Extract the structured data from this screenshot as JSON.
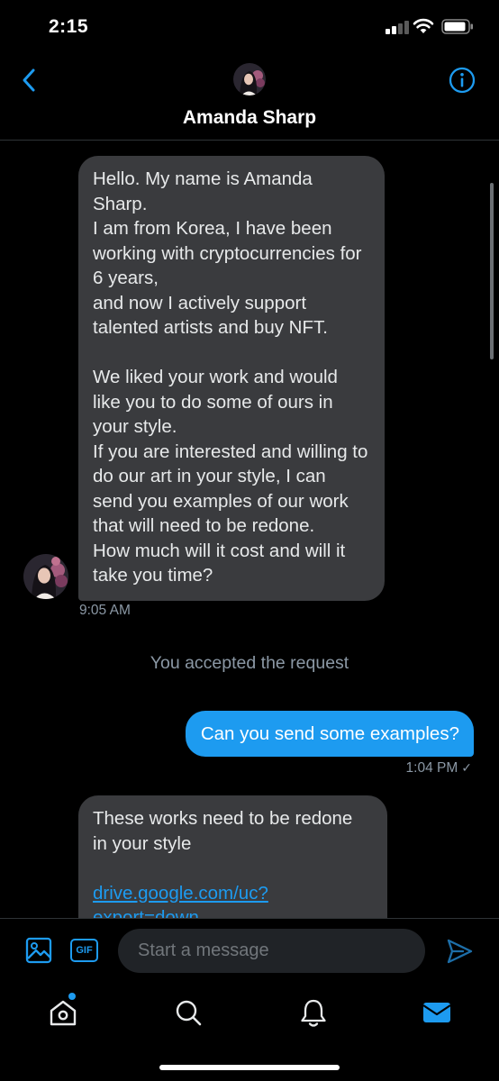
{
  "status_bar": {
    "time": "2:15",
    "icons": [
      "cellular-signal-icon",
      "wifi-icon",
      "battery-icon"
    ]
  },
  "header": {
    "contact_name": "Amanda Sharp",
    "back_icon": "chevron-left-icon",
    "info_icon": "info-circle-icon"
  },
  "messages": [
    {
      "direction": "incoming",
      "text": "Hello. My name is Amanda Sharp.\nI am from Korea, I have been working with cryptocurrencies for 6 years,\nand now I actively support talented artists and buy NFT.\n\nWe liked your work and would like you to do some of ours in your style.\nIf you are interested and willing to do our art in your style, I can send you examples of our work that will need to be redone.\nHow much will it cost and will it take you time?",
      "time": "9:05 AM"
    },
    {
      "direction": "system",
      "text": "You accepted the request"
    },
    {
      "direction": "outgoing",
      "text": "Can you send some examples?",
      "time": "1:04 PM",
      "status_icon": "checkmark-icon",
      "status_glyph": "✓"
    },
    {
      "direction": "incoming",
      "text_line_1": "These works need to be redone",
      "text_line_2": "in your style",
      "link_line_1": "drive.google.com/uc?",
      "link_line_2": "export=down"
    }
  ],
  "composer": {
    "placeholder": "Start a message",
    "value": "",
    "gif_label": "GIF",
    "media_icon": "image-icon",
    "send_icon": "send-icon"
  },
  "tab_bar": {
    "tabs": [
      "home-icon",
      "search-icon",
      "bell-icon",
      "mail-icon"
    ],
    "active": "mail-icon",
    "home_has_notification_dot": true
  },
  "colors": {
    "accent": "#1d9bf0",
    "background": "#000000",
    "incoming_bubble": "#3a3b3e",
    "secondary_text": "#8b98a5"
  }
}
